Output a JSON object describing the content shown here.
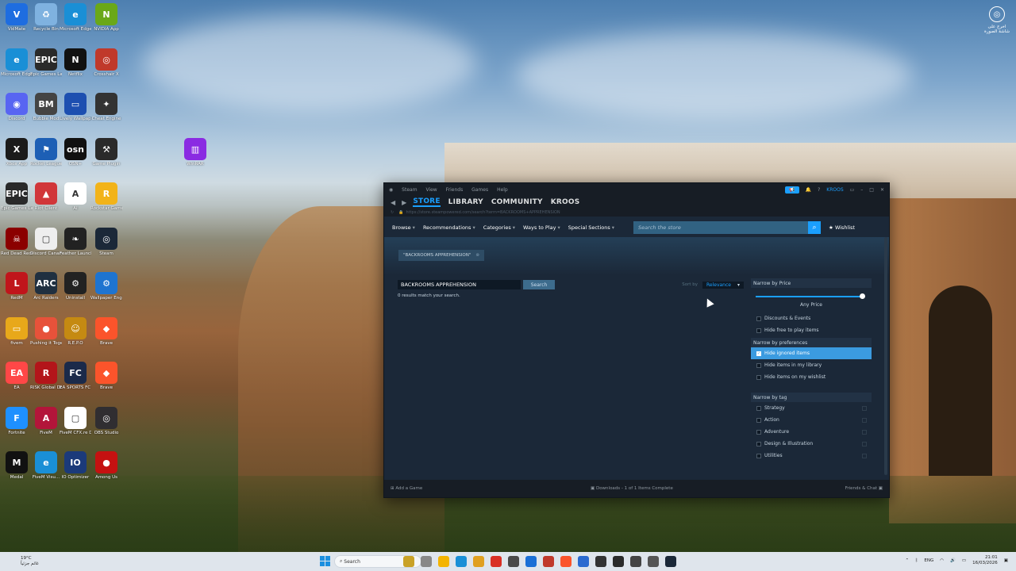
{
  "desktop": {
    "icons": [
      {
        "label": "VidMate",
        "color": "#1e6de0",
        "glyph": "V"
      },
      {
        "label": "Recycle Bin",
        "color": "#7fb2e0",
        "glyph": "♻"
      },
      {
        "label": "Microsoft Edge",
        "color": "#1a8fd6",
        "glyph": "e"
      },
      {
        "label": "NVIDIA App",
        "color": "#6aa818",
        "glyph": "N"
      },
      {
        "label": "Microsoft Edge",
        "color": "#1a8fd6",
        "glyph": "e"
      },
      {
        "label": "Epic Games Launcher",
        "color": "#2a2a2a",
        "glyph": "EPIC"
      },
      {
        "label": "Netflix",
        "color": "#111",
        "glyph": "N"
      },
      {
        "label": "Crosshair X",
        "color": "#c0392b",
        "glyph": "◎"
      },
      {
        "label": "Discord",
        "color": "#5865f2",
        "glyph": "◉"
      },
      {
        "label": "Bubble Mod",
        "color": "#444",
        "glyph": "BM"
      },
      {
        "label": "Lively Wallpaper",
        "color": "#1d4fb0",
        "glyph": "▭"
      },
      {
        "label": "Cheat Engine",
        "color": "#333",
        "glyph": "✦"
      },
      {
        "label": "Xbox App",
        "color": "#1b1b1b",
        "glyph": "X"
      },
      {
        "label": "Rocket League",
        "color": "#1d5fb5",
        "glyph": "⚑"
      },
      {
        "label": "OSN+",
        "color": "#111",
        "glyph": "osn"
      },
      {
        "label": "Game Plugin",
        "color": "#2a2a2a",
        "glyph": "⚒"
      },
      {
        "label": "WinRAR",
        "color": "#8a2be2",
        "glyph": "▥"
      },
      {
        "label": "Epic Games Launcher",
        "color": "#2a2a2a",
        "glyph": "EPIC"
      },
      {
        "label": "Riot Client",
        "color": "#d13639",
        "glyph": "▲"
      },
      {
        "label": "AI",
        "color": "#fff",
        "glyph": "A"
      },
      {
        "label": "Rockstar Games",
        "color": "#f2b319",
        "glyph": "R"
      },
      {
        "label": "Red Dead Redemption",
        "color": "#8b0000",
        "glyph": "☠"
      },
      {
        "label": "Discord Canary",
        "color": "#eee",
        "glyph": "▢"
      },
      {
        "label": "Feather Launcher",
        "color": "#222",
        "glyph": "❧"
      },
      {
        "label": "Steam",
        "color": "#1b2838",
        "glyph": "◎"
      },
      {
        "label": "RedM",
        "color": "#c0151b",
        "glyph": "L"
      },
      {
        "label": "Arc Raiders",
        "color": "#203040",
        "glyph": "ARC"
      },
      {
        "label": "Uninstall",
        "color": "#222",
        "glyph": "⚙"
      },
      {
        "label": "Wallpaper Engine",
        "color": "#1e74d0",
        "glyph": "⚙"
      },
      {
        "label": "fivem",
        "color": "#e8a81a",
        "glyph": "▭"
      },
      {
        "label": "Pushing it Together",
        "color": "#e7523a",
        "glyph": "●"
      },
      {
        "label": "R.E.P.O",
        "color": "#c58a12",
        "glyph": "☺"
      },
      {
        "label": "Brave",
        "color": "#fb542b",
        "glyph": "◆"
      },
      {
        "label": "EA",
        "color": "#ff4747",
        "glyph": "EA"
      },
      {
        "label": "RISK Global Domination",
        "color": "#b3151a",
        "glyph": "R"
      },
      {
        "label": "EA SPORTS FC™ 26",
        "color": "#1b2a4a",
        "glyph": "FC"
      },
      {
        "label": "Brave",
        "color": "#fb542b",
        "glyph": "◆"
      },
      {
        "label": "Fortnite",
        "color": "#1e90ff",
        "glyph": "F"
      },
      {
        "label": "FiveM",
        "color": "#b3153a",
        "glyph": "A"
      },
      {
        "label": "FiveM CFX.re Devel...",
        "color": "#fff",
        "glyph": "▢"
      },
      {
        "label": "OBS Studio",
        "color": "#302e31",
        "glyph": "◎"
      },
      {
        "label": "Medal",
        "color": "#111",
        "glyph": "M"
      },
      {
        "label": "FiveM Visu...",
        "color": "#1a8fd6",
        "glyph": "e"
      },
      {
        "label": "IO Optimizer",
        "color": "#1b3a7a",
        "glyph": "IO"
      },
      {
        "label": "Among Us",
        "color": "#c51111",
        "glyph": "●"
      }
    ],
    "top_right_label": "اخرج على شاشة الصورة"
  },
  "steam": {
    "menu": [
      "Steam",
      "View",
      "Friends",
      "Games",
      "Help"
    ],
    "announce_icon": "megaphone-icon",
    "account_name": "KROOS",
    "nav_tabs": [
      "STORE",
      "LIBRARY",
      "COMMUNITY",
      "KROOS"
    ],
    "active_tab": "STORE",
    "url": "https://store.steampowered.com/search?term=BACKROOMS+APPREHENSION",
    "store_tabs": [
      "Browse",
      "Recommendations",
      "Categories",
      "Ways to Play",
      "Special Sections"
    ],
    "search_placeholder": "Search the store",
    "wishlist_label": "Wishlist",
    "chip_label": "\"BACKROOMS APPREHENSION\"",
    "search_value": "BACKROOMS APPREHENSION",
    "search_button": "Search",
    "sort_label": "Sort by",
    "sort_value": "Relevance",
    "results_text": "0 results match your search.",
    "price_heading": "Narrow by Price",
    "price_value": "Any Price",
    "price_options": [
      {
        "label": "Discounts & Events",
        "checked": false
      },
      {
        "label": "Hide free to play items",
        "checked": false
      }
    ],
    "pref_heading": "Narrow by preferences",
    "pref_options": [
      {
        "label": "Hide ignored items",
        "checked": true
      },
      {
        "label": "Hide items in my library",
        "checked": false
      },
      {
        "label": "Hide items on my wishlist",
        "checked": false
      }
    ],
    "tag_heading": "Narrow by tag",
    "tag_options": [
      "Strategy",
      "Action",
      "Adventure",
      "Design & Illustration",
      "Utilities"
    ],
    "footer_add_game": "Add a Game",
    "footer_downloads": "Downloads - 1 of 1 Items Complete",
    "footer_friends": "Friends & Chat"
  },
  "taskbar": {
    "temperature": "19°C",
    "weather_text": "غائم جزئياً",
    "search_label": "Search",
    "language": "ENG",
    "time": "21:01",
    "date": "16/03/2026"
  }
}
